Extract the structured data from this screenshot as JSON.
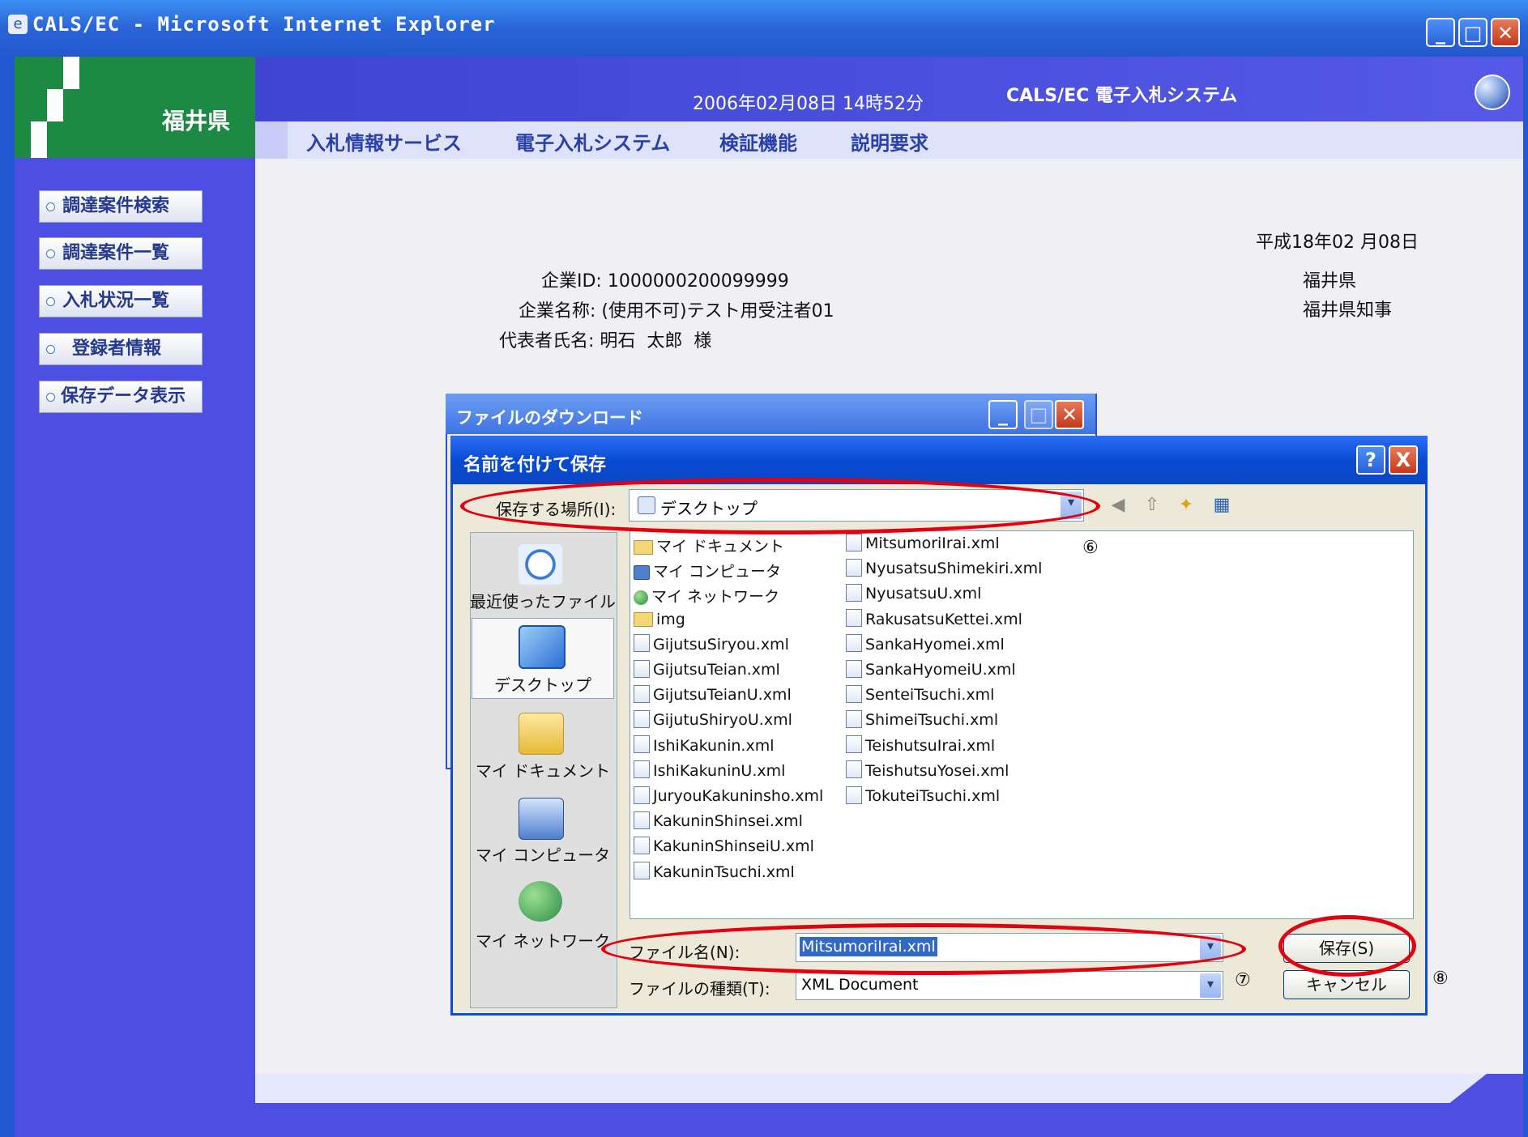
{
  "window": {
    "title": "CALS/EC - Microsoft Internet Explorer"
  },
  "header": {
    "logo_text": "福井県",
    "datetime": "2006年02月08日 14時52分",
    "system_name": "CALS/EC 電子入札システム",
    "menu": [
      "入札情報サービス",
      "電子入札システム",
      "検証機能",
      "説明要求"
    ]
  },
  "sidebar": {
    "items": [
      {
        "label": "調達案件検索"
      },
      {
        "label": "調達案件一覧"
      },
      {
        "label": "入札状況一覧"
      },
      {
        "label": "登録者情報"
      },
      {
        "label": "保存データ表示"
      }
    ]
  },
  "document": {
    "date": "平成18年02 月08日",
    "issuer1": "福井県",
    "issuer2": "福井県知事",
    "company_id": "企業ID: 1000000200099999",
    "company_name": "企業名称: (使用不可)テスト用受注者01",
    "representative": "代表者氏名: 明石  太郎  様"
  },
  "download_dialog": {
    "title": "ファイルのダウンロード"
  },
  "save_dialog": {
    "title": "名前を付けて保存",
    "location_label": "保存する場所(I):",
    "location_value": "デスクトップ",
    "places": [
      "最近使ったファイル",
      "デスクトップ",
      "マイ ドキュメント",
      "マイ コンピュータ",
      "マイ ネットワーク"
    ],
    "files_col1": [
      {
        "name": "マイ ドキュメント",
        "icon": "folder-icon"
      },
      {
        "name": "マイ コンピュータ",
        "icon": "computer-icon"
      },
      {
        "name": "マイ ネットワーク",
        "icon": "network-icon"
      },
      {
        "name": "img",
        "icon": "folder-icon"
      },
      {
        "name": "GijutsuSiryou.xml",
        "icon": "xml-file-icon"
      },
      {
        "name": "GijutsuTeian.xml",
        "icon": "xml-file-icon"
      },
      {
        "name": "GijutsuTeianU.xml",
        "icon": "xml-file-icon"
      },
      {
        "name": "GijutuShiryoU.xml",
        "icon": "xml-file-icon"
      },
      {
        "name": "IshiKakunin.xml",
        "icon": "xml-file-icon"
      },
      {
        "name": "IshiKakuninU.xml",
        "icon": "xml-file-icon"
      },
      {
        "name": "JuryouKakuninsho.xml",
        "icon": "xml-file-icon"
      },
      {
        "name": "KakuninShinsei.xml",
        "icon": "xml-file-icon"
      },
      {
        "name": "KakuninShinseiU.xml",
        "icon": "xml-file-icon"
      },
      {
        "name": "KakuninTsuchi.xml",
        "icon": "xml-file-icon"
      }
    ],
    "files_col2": [
      {
        "name": "MitsumoriIrai.xml"
      },
      {
        "name": "NyusatsuShimekiri.xml"
      },
      {
        "name": "NyusatsuU.xml"
      },
      {
        "name": "RakusatsuKettei.xml"
      },
      {
        "name": "SankaHyomei.xml"
      },
      {
        "name": "SankaHyomeiU.xml"
      },
      {
        "name": "SenteiTsuchi.xml"
      },
      {
        "name": "ShimeiTsuchi.xml"
      },
      {
        "name": "TeishutsuIrai.xml"
      },
      {
        "name": "TeishutsuYosei.xml"
      },
      {
        "name": "TokuteiTsuchi.xml"
      }
    ],
    "filename_label": "ファイル名(N):",
    "filename_value": "MitsumoriIrai.xml",
    "filetype_label": "ファイルの種類(T):",
    "filetype_value": "XML Document",
    "save_button": "保存(S)",
    "cancel_button": "キャンセル",
    "help_button": "?",
    "close_button": "X"
  },
  "annotations": {
    "marker6": "⑥",
    "marker7": "⑦",
    "marker8": "⑧"
  },
  "colors": {
    "accent_red": "#e4000f",
    "title_blue": "#0a4fd6",
    "nav_blue": "#4c4fe2"
  }
}
